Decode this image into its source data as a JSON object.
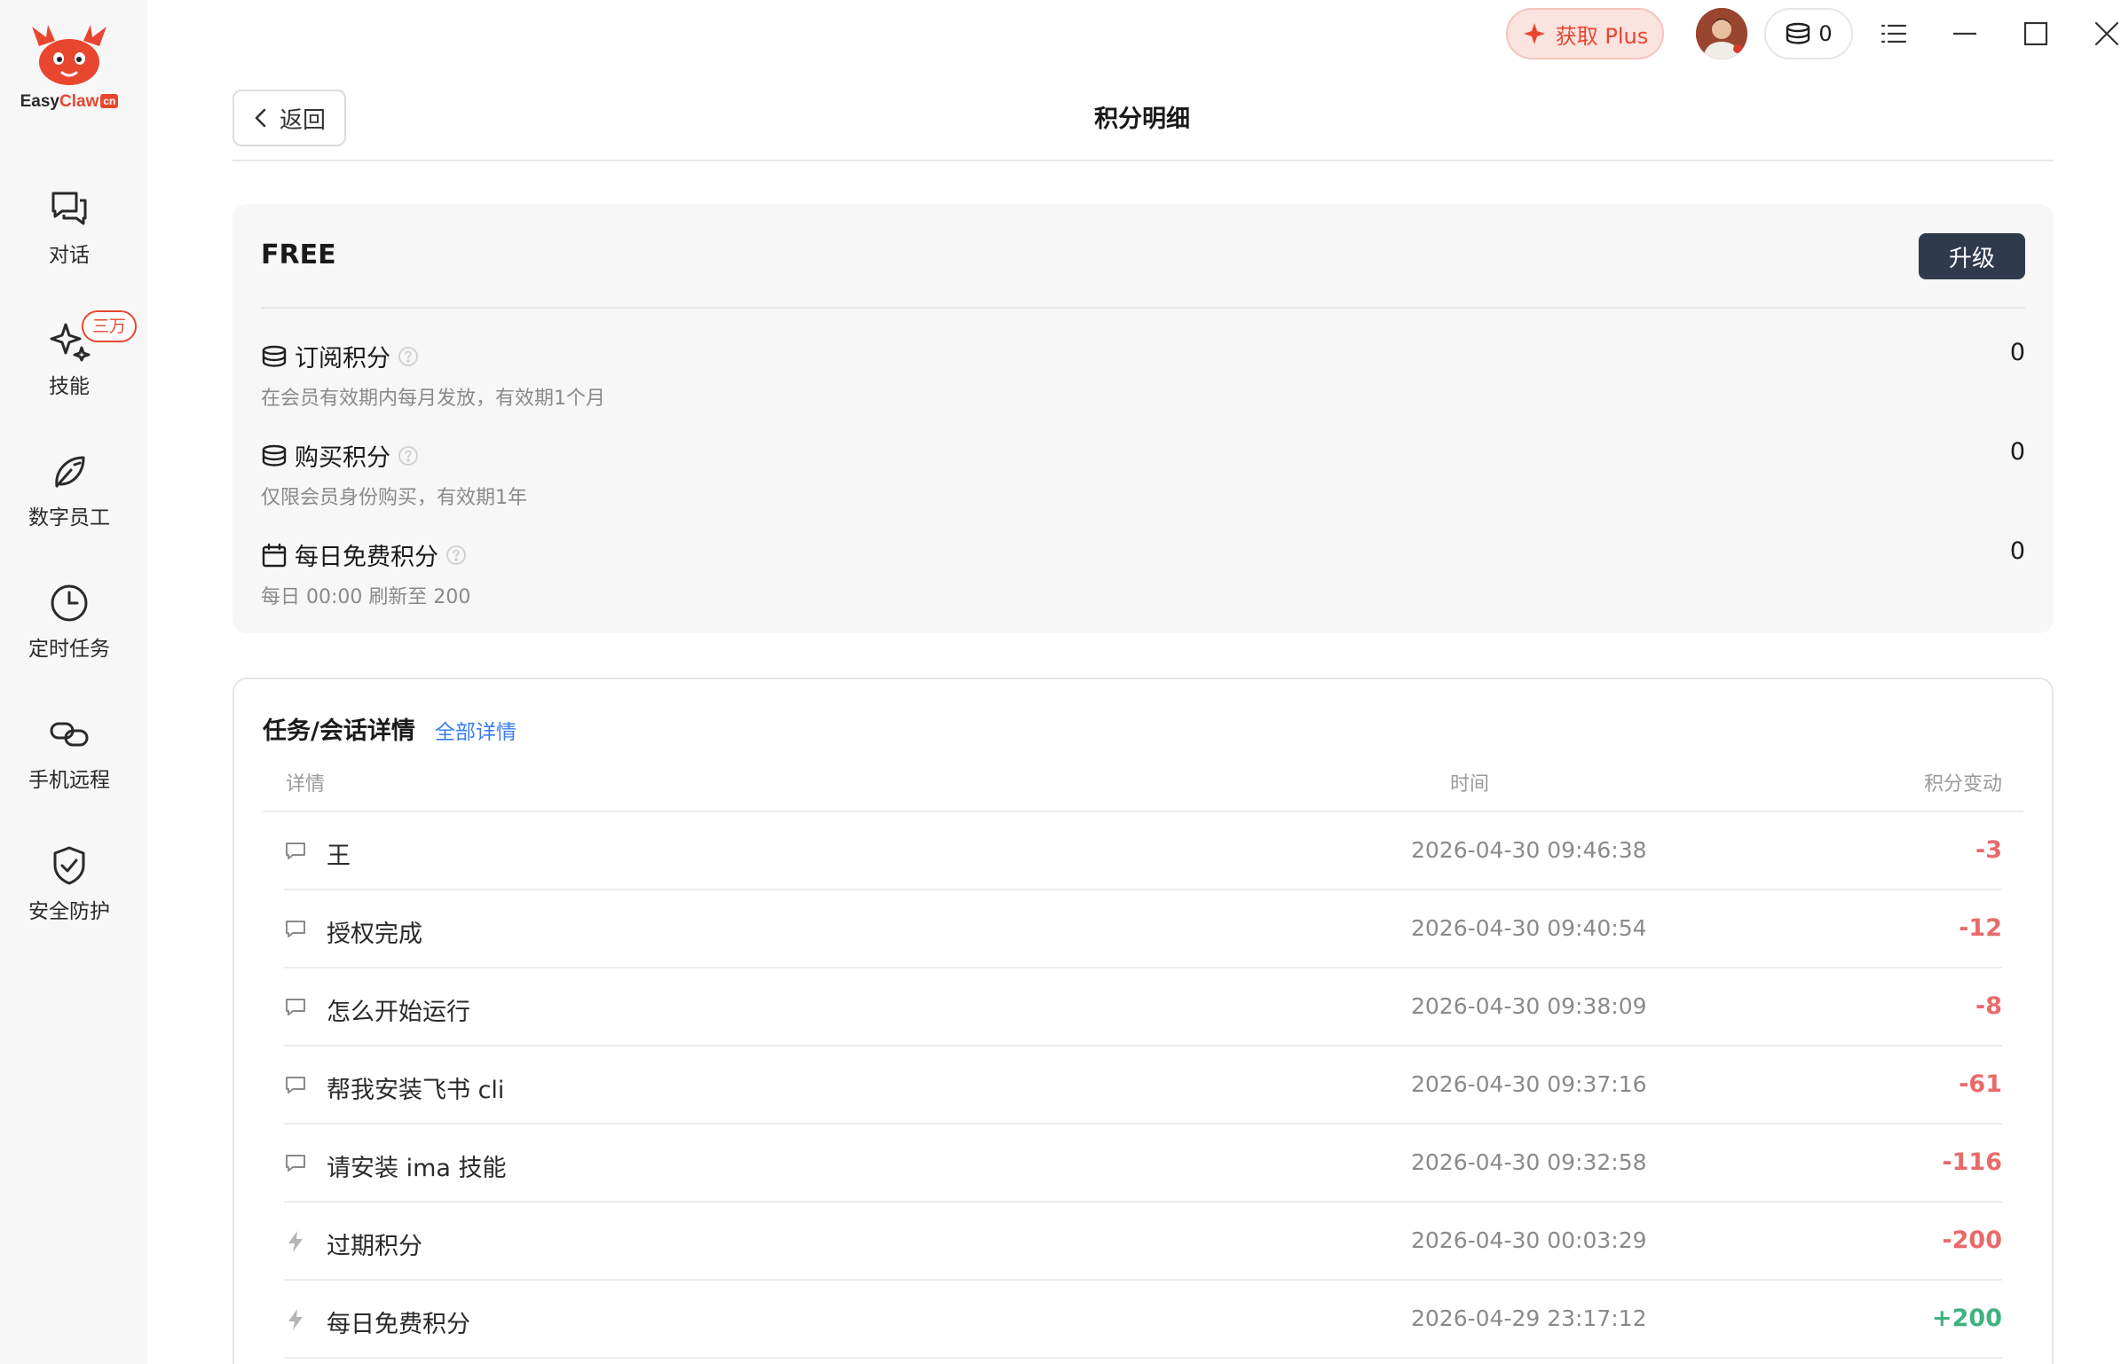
{
  "brand": {
    "name_part1": "Easy",
    "name_part2": "Claw",
    "suffix": "cn"
  },
  "sidebar": {
    "items": [
      {
        "id": "chat",
        "label": "对话",
        "icon": "chat-bubbles-icon"
      },
      {
        "id": "skills",
        "label": "技能",
        "icon": "sparkle-icon",
        "badge": "三万"
      },
      {
        "id": "digital-staff",
        "label": "数字员工",
        "icon": "leaf-icon"
      },
      {
        "id": "scheduled",
        "label": "定时任务",
        "icon": "clock-icon"
      },
      {
        "id": "remote",
        "label": "手机远程",
        "icon": "link-icon"
      },
      {
        "id": "security",
        "label": "安全防护",
        "icon": "shield-check-icon"
      }
    ]
  },
  "topbar": {
    "plus_label": "获取 Plus",
    "coins": "0"
  },
  "header": {
    "back_label": "返回",
    "title": "积分明细"
  },
  "credits": {
    "plan": "FREE",
    "upgrade_label": "升级",
    "rows": [
      {
        "title": "订阅积分",
        "desc": "在会员有效期内每月发放，有效期1个月",
        "value": "0",
        "icon": "coins-icon"
      },
      {
        "title": "购买积分",
        "desc": "仅限会员身份购买，有效期1年",
        "value": "0",
        "icon": "coins-icon"
      },
      {
        "title": "每日免费积分",
        "desc": "每日 00:00 刷新至 200",
        "value": "0",
        "icon": "calendar-icon"
      }
    ]
  },
  "tasks": {
    "title": "任务/会话详情",
    "link": "全部详情",
    "columns": {
      "detail": "详情",
      "time": "时间",
      "change": "积分变动"
    },
    "rows": [
      {
        "icon": "chat-icon",
        "detail": "王",
        "time": "2026-04-30 09:46:38",
        "change": "-3"
      },
      {
        "icon": "chat-icon",
        "detail": "授权完成",
        "time": "2026-04-30 09:40:54",
        "change": "-12"
      },
      {
        "icon": "chat-icon",
        "detail": "怎么开始运行",
        "time": "2026-04-30 09:38:09",
        "change": "-8"
      },
      {
        "icon": "chat-icon",
        "detail": "帮我安装飞书 cli",
        "time": "2026-04-30 09:37:16",
        "change": "-61"
      },
      {
        "icon": "chat-icon",
        "detail": "请安装 ima 技能",
        "time": "2026-04-30 09:32:58",
        "change": "-116"
      },
      {
        "icon": "bolt-icon",
        "detail": "过期积分",
        "time": "2026-04-30 00:03:29",
        "change": "-200"
      },
      {
        "icon": "bolt-icon",
        "detail": "每日免费积分",
        "time": "2026-04-29 23:17:12",
        "change": "+200"
      }
    ]
  },
  "colors": {
    "accent": "#e8462f",
    "negative": "#e86b6b",
    "positive": "#3fb37f",
    "link": "#3a7df0",
    "upgrade": "#2f3b4d"
  }
}
